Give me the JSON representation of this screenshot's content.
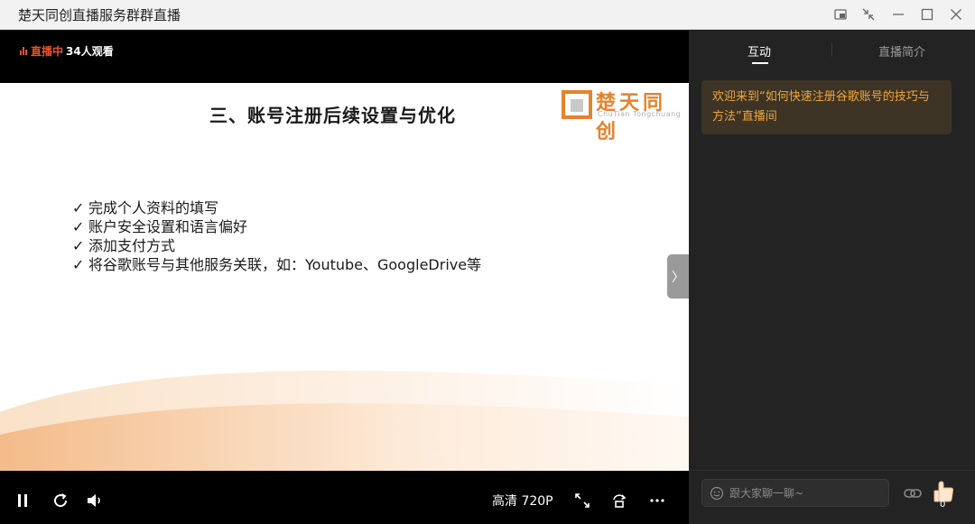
{
  "window": {
    "title": "楚天同创直播服务群群直播"
  },
  "player": {
    "live_label": "直播中",
    "viewers": "34人观看",
    "quality": "高清 720P"
  },
  "slide": {
    "title": "三、账号注册后续设置与优化",
    "logo_cn": "楚天同创",
    "logo_en": "ChuTian Tongchuang",
    "check_mark": "✓",
    "bullets": [
      "完成个人资料的填写",
      "账户安全设置和语言偏好",
      "添加支付方式",
      "将谷歌账号与其他服务关联，如：Youtube、GoogleDrive等"
    ]
  },
  "panel": {
    "tabs": [
      {
        "label": "互动",
        "active": true
      },
      {
        "label": "直播简介",
        "active": false
      }
    ],
    "welcome_message": "欢迎来到“如何快速注册谷歌账号的技巧与方法”直播间",
    "chat_placeholder": "跟大家聊一聊~",
    "like_count": "0"
  },
  "colors": {
    "accent_orange": "#e8822a",
    "live_red": "#e8532f",
    "welcome_text": "#f0a63a"
  }
}
